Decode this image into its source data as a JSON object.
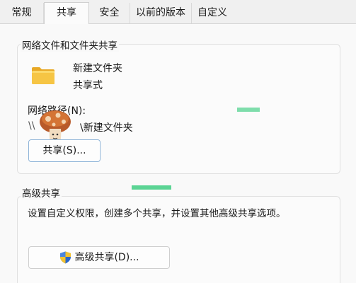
{
  "tabs": [
    {
      "label": "常规",
      "active": false
    },
    {
      "label": "共享",
      "active": true
    },
    {
      "label": "安全",
      "active": false
    },
    {
      "label": "以前的版本",
      "active": false
    },
    {
      "label": "自定义",
      "active": false
    }
  ],
  "network_share": {
    "group_title": "网络文件和文件夹共享",
    "folder_name": "新建文件夹",
    "share_status": "共享式",
    "path_label": "网络路径(N):",
    "path_value_prefix": "\\\\",
    "path_value_suffix": "\\新建文件夹",
    "share_button_label": "共享(S)..."
  },
  "advanced_share": {
    "group_title": "高级共享",
    "description": "设置自定义权限，创建多个共享，并设置其他高级共享选项。",
    "button_label": "高级共享(D)..."
  },
  "colors": {
    "accent_green": "#18c46a",
    "folder_yellow": "#f6c544",
    "focus_border": "#8fb4d8"
  }
}
